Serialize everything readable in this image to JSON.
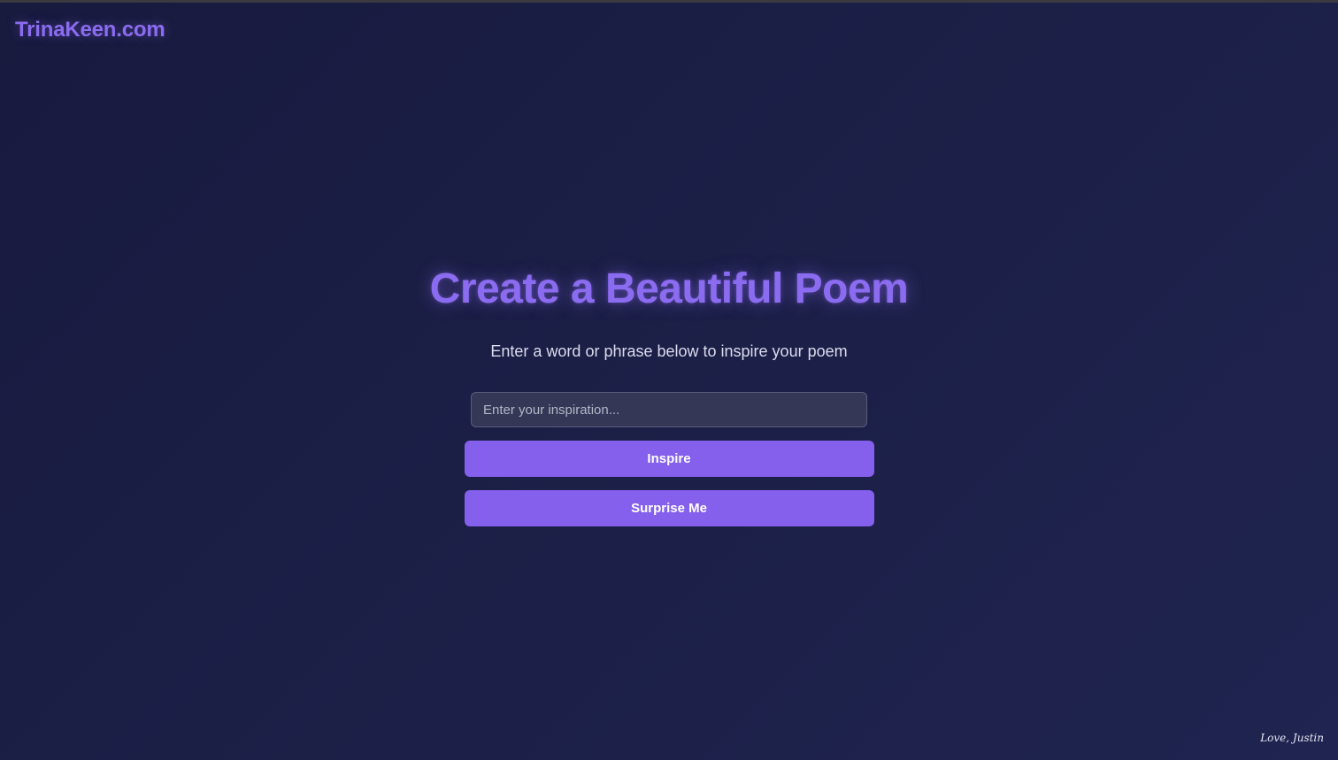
{
  "header": {
    "brand": "TrinaKeen.com"
  },
  "main": {
    "title": "Create a Beautiful Poem",
    "subtitle": "Enter a word or phrase below to inspire your poem",
    "input": {
      "value": "",
      "placeholder": "Enter your inspiration..."
    },
    "inspire_label": "Inspire",
    "surprise_label": "Surprise Me"
  },
  "footer": {
    "signature": "Love, Justin"
  },
  "colors": {
    "accent": "#8460ec",
    "title": "#8b6cf0",
    "background": "#1c2048"
  }
}
